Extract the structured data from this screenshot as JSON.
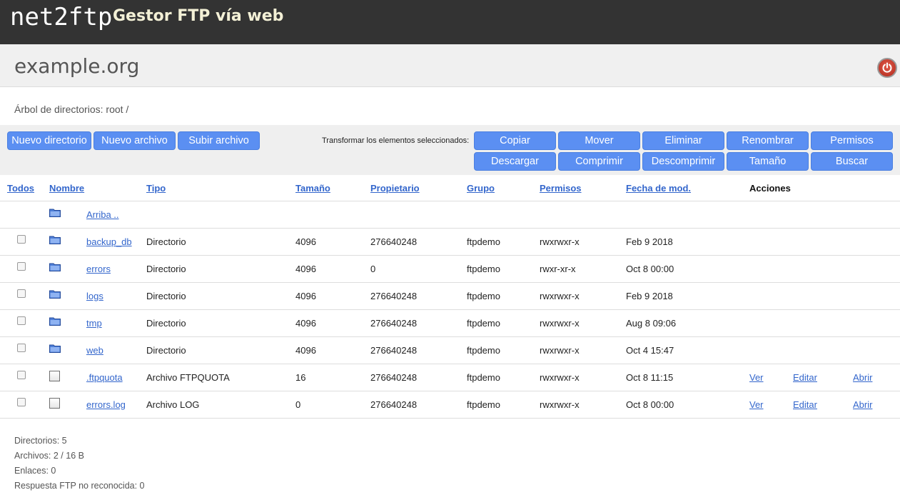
{
  "header": {
    "logo": "net2ftp",
    "title": "Gestor FTP vía web"
  },
  "host": {
    "name": "example.org",
    "logout_icon": "power-icon"
  },
  "breadcrumb": {
    "label": "Árbol de directorios:",
    "path": "root /"
  },
  "toolbar": {
    "new_dir": "Nuevo directorio",
    "new_file": "Nuevo archivo",
    "upload": "Subir archivo",
    "transform_label": "Transformar los elementos seleccionados:",
    "actions_row1": [
      "Copiar",
      "Mover",
      "Eliminar",
      "Renombrar",
      "Permisos"
    ],
    "actions_row2": [
      "Descargar",
      "Comprimir",
      "Descomprimir",
      "Tamaño",
      "Buscar"
    ]
  },
  "table": {
    "headers": {
      "all": "Todos",
      "name": "Nombre",
      "type": "Tipo",
      "size": "Tamaño",
      "owner": "Propietario",
      "group": "Grupo",
      "perms": "Permisos",
      "modified": "Fecha de mod.",
      "actions": "Acciones"
    },
    "up_label": "Arriba ..",
    "rows": [
      {
        "name": "backup_db",
        "type": "Directorio",
        "size": "4096",
        "owner": "276640248",
        "group": "ftpdemo",
        "perms": "rwxrwxr-x",
        "date": "Feb 9 2018",
        "is_dir": true
      },
      {
        "name": "errors",
        "type": "Directorio",
        "size": "4096",
        "owner": "0",
        "group": "ftpdemo",
        "perms": "rwxr-xr-x",
        "date": "Oct 8 00:00",
        "is_dir": true
      },
      {
        "name": "logs",
        "type": "Directorio",
        "size": "4096",
        "owner": "276640248",
        "group": "ftpdemo",
        "perms": "rwxrwxr-x",
        "date": "Feb 9 2018",
        "is_dir": true
      },
      {
        "name": "tmp",
        "type": "Directorio",
        "size": "4096",
        "owner": "276640248",
        "group": "ftpdemo",
        "perms": "rwxrwxr-x",
        "date": "Aug 8 09:06",
        "is_dir": true
      },
      {
        "name": "web",
        "type": "Directorio",
        "size": "4096",
        "owner": "276640248",
        "group": "ftpdemo",
        "perms": "rwxrwxr-x",
        "date": "Oct 4 15:47",
        "is_dir": true
      },
      {
        "name": ".ftpquota",
        "type": "Archivo FTPQUOTA",
        "size": "16",
        "owner": "276640248",
        "group": "ftpdemo",
        "perms": "rwxrwxr-x",
        "date": "Oct 8 11:15",
        "is_dir": false
      },
      {
        "name": "errors.log",
        "type": "Archivo LOG",
        "size": "0",
        "owner": "276640248",
        "group": "ftpdemo",
        "perms": "rwxrwxr-x",
        "date": "Oct 8 00:00",
        "is_dir": false
      }
    ],
    "file_actions": {
      "view": "Ver",
      "edit": "Editar",
      "open": "Abrir"
    }
  },
  "stats": {
    "dirs": "Directorios: 5",
    "files": "Archivos: 2 / 16 B",
    "links": "Enlaces: 0",
    "unrecognized": "Respuesta FTP no reconocida: 0"
  },
  "colors": {
    "topbar": "#333333",
    "button": "#5b8ff2",
    "link": "#3366cc"
  }
}
